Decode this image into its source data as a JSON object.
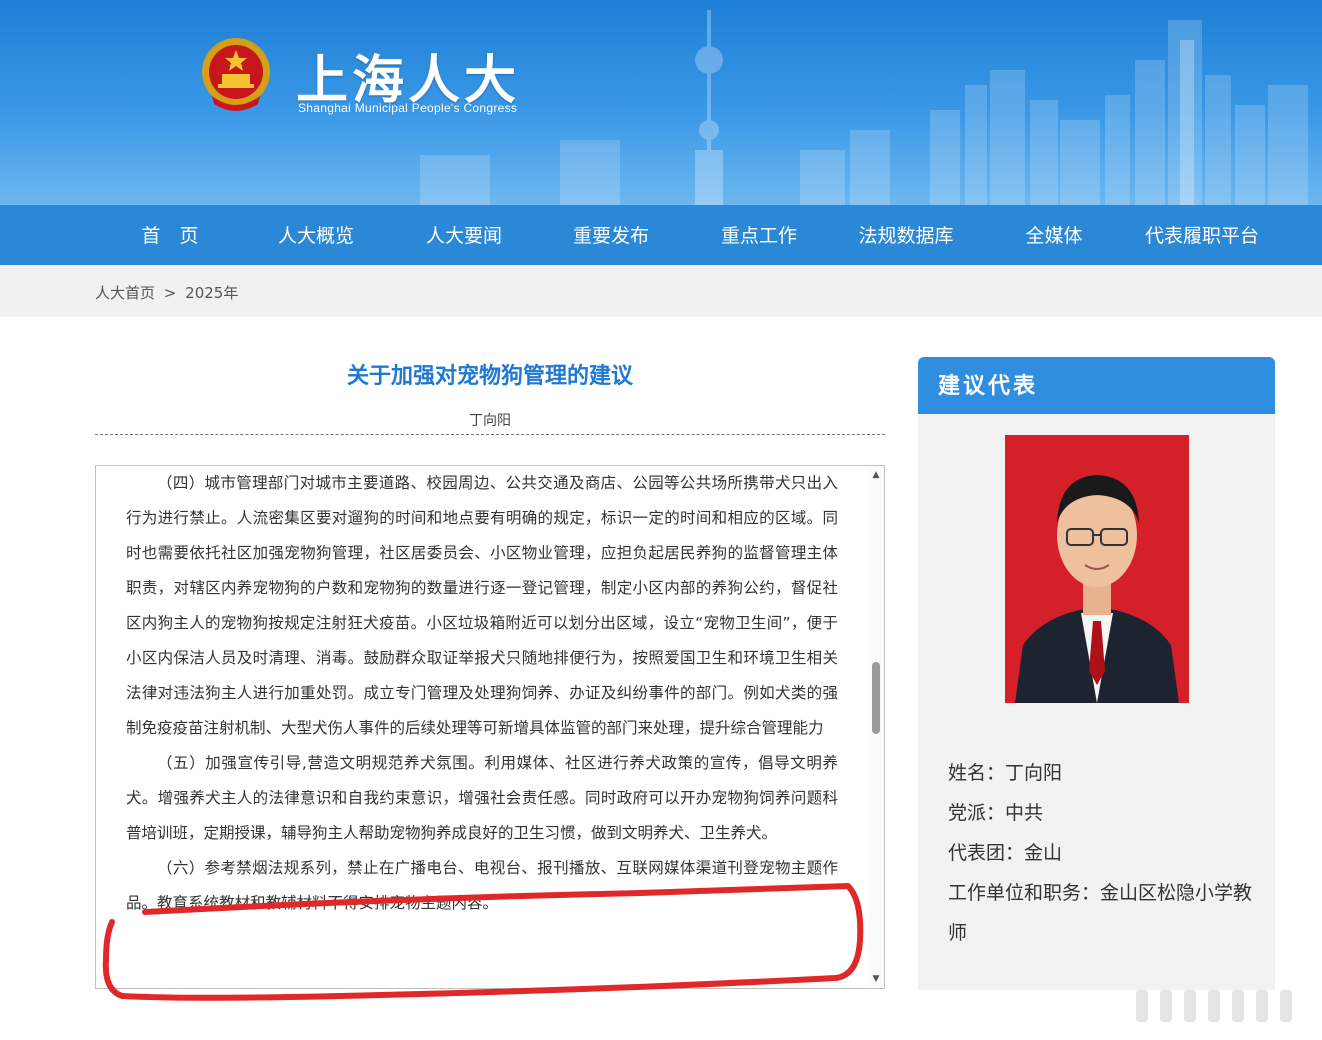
{
  "header": {
    "title": "上海人大",
    "subtitle": "Shanghai Municipal People's Congress"
  },
  "nav": {
    "items": [
      "首　页",
      "人大概览",
      "人大要闻",
      "重要发布",
      "重点工作",
      "法规数据库",
      "全媒体",
      "代表履职平台"
    ]
  },
  "breadcrumb": {
    "home": "人大首页",
    "sep": ">",
    "current": "2025年"
  },
  "article": {
    "title": "关于加强对宠物狗管理的建议",
    "author": "丁向阳",
    "paragraphs": [
      "（四）城市管理部门对城市主要道路、校园周边、公共交通及商店、公园等公共场所携带犬只出入行为进行禁止。人流密集区要对遛狗的时间和地点要有明确的规定，标识一定的时间和相应的区域。同时也需要依托社区加强宠物狗管理，社区居委员会、小区物业管理，应担负起居民养狗的监督管理主体职责，对辖区内养宠物狗的户数和宠物狗的数量进行逐一登记管理，制定小区内部的养狗公约，督促社区内狗主人的宠物狗按规定注射狂犬疫苗。小区垃圾箱附近可以划分出区域，设立“宠物卫生间”，便于小区内保洁人员及时清理、消毒。鼓励群众取证举报犬只随地排便行为，按照爱国卫生和环境卫生相关法律对违法狗主人进行加重处罚。成立专门管理及处理狗饲养、办证及纠纷事件的部门。例如犬类的强制免疫疫苗注射机制、大型犬伤人事件的后续处理等可新增具体监管的部门来处理，提升综合管理能力",
      "（五）加强宣传引导,营造文明规范养犬氛围。利用媒体、社区进行养犬政策的宣传，倡导文明养犬。增强养犬主人的法律意识和自我约束意识，增强社会责任感。同时政府可以开办宠物狗饲养问题科普培训班，定期授课，辅导狗主人帮助宠物狗养成良好的卫生习惯，做到文明养犬、卫生养犬。",
      "（六）参考禁烟法规系列，禁止在广播电台、电视台、报刊播放、互联网媒体渠道刊登宠物主题作品。教育系统教材和教辅材料不得安排宠物主题内容。"
    ]
  },
  "sidebar": {
    "heading": "建议代表",
    "fields": [
      {
        "label": "姓名：",
        "value": "丁向阳"
      },
      {
        "label": "党派：",
        "value": "中共"
      },
      {
        "label": "代表团：",
        "value": "金山"
      },
      {
        "label": "工作单位和职务：",
        "value": "金山区松隐小学教师"
      }
    ]
  },
  "colors": {
    "brand_blue": "#2a88d6",
    "title_blue": "#1f78d1",
    "annotation_red": "#e0282a",
    "portrait_bg": "#d5202a"
  }
}
